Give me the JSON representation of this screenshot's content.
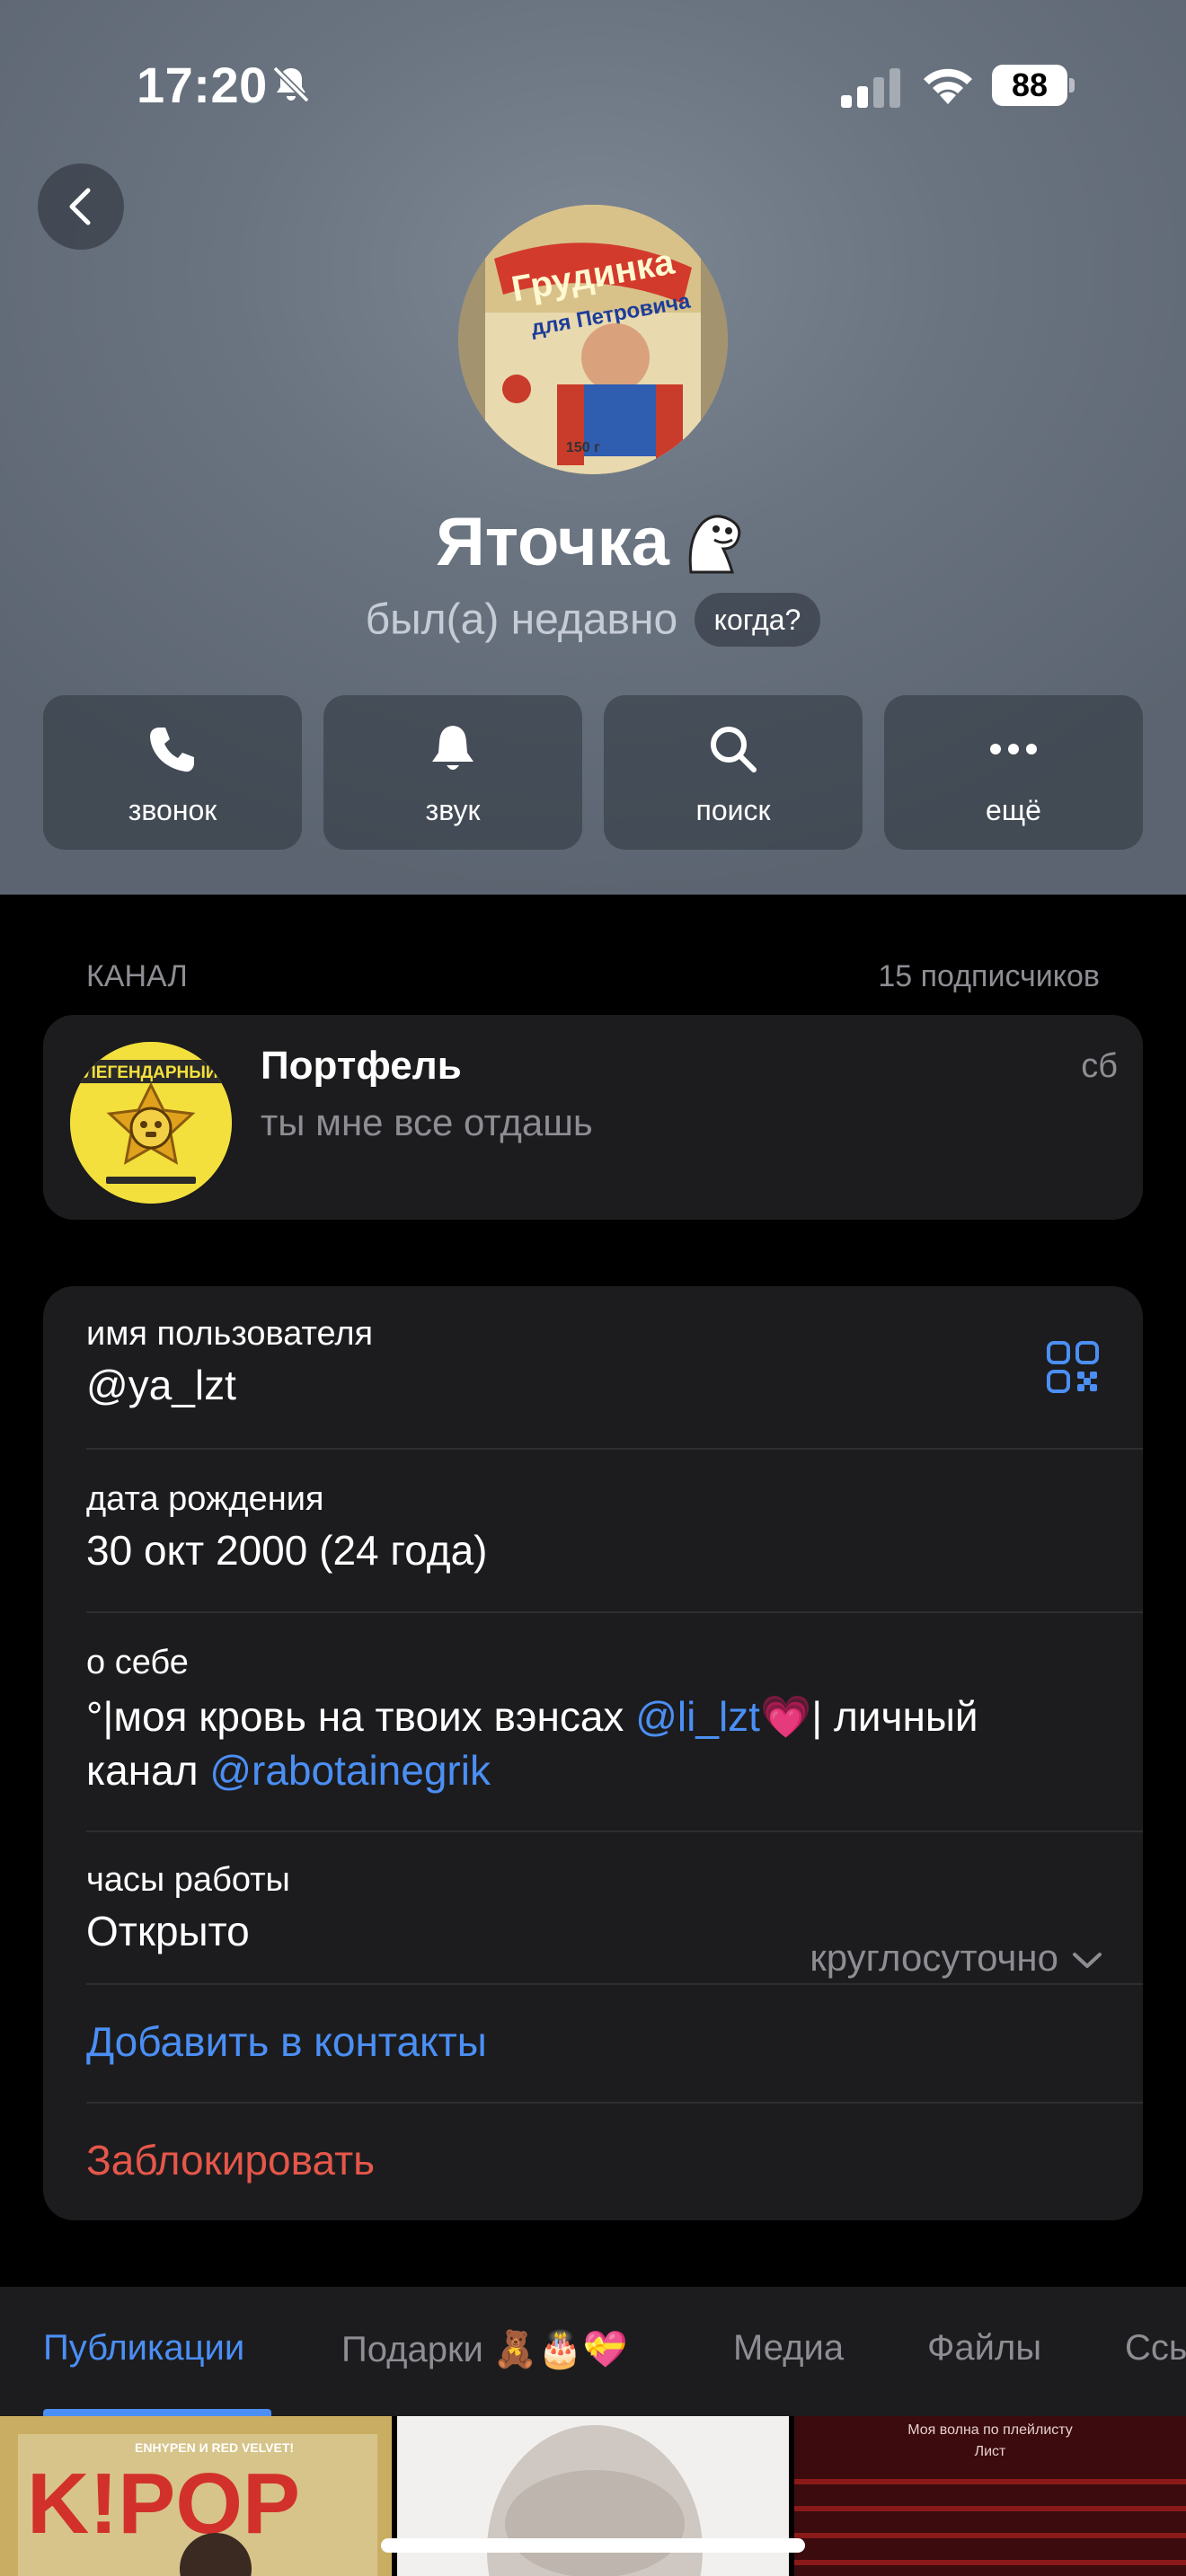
{
  "status_bar": {
    "time": "17:20",
    "battery": "88",
    "icons": [
      "bell-off-icon",
      "cellular-signal-icon",
      "wifi-icon",
      "battery-icon"
    ]
  },
  "profile": {
    "name": "Яточка",
    "status": "был(а) недавно",
    "when_button": "когда?",
    "avatar": {
      "title": "Грудинка",
      "subtitle": "для Петровича",
      "weight": "150 г"
    }
  },
  "actions": [
    {
      "label": "звонок",
      "icon": "phone-icon"
    },
    {
      "label": "звук",
      "icon": "bell-icon"
    },
    {
      "label": "поиск",
      "icon": "search-icon"
    },
    {
      "label": "ещё",
      "icon": "more-icon"
    }
  ],
  "channel_section": {
    "heading": "КАНАЛ",
    "subscribers": "15 подписчиков",
    "channel": {
      "name": "Портфель",
      "last_message": "ты мне все отдашь",
      "date": "сб",
      "avatar_text": "ЛЕГЕНДАРНЫЙ"
    }
  },
  "info": {
    "username_label": "имя пользователя",
    "username": "@ya_lzt",
    "birthday_label": "дата рождения",
    "birthday": "30 окт 2000 (24 года)",
    "about_label": "о себе",
    "about_part1": "°|моя кровь на твоих вэнсах ",
    "about_mention1": "@li_lzt",
    "about_heart": "💗",
    "about_part2": "| личный",
    "about_part3": "канал ",
    "about_mention2": "@rabotainegrik",
    "hours_label": "часы работы",
    "hours_status": "Открыто",
    "hours_value": "круглосуточно",
    "add_contact": "Добавить в контакты",
    "block": "Заблокировать"
  },
  "tabs": [
    {
      "label": "Публикации",
      "active": true
    },
    {
      "label": "Подарки 🧸🎂💝",
      "active": false
    },
    {
      "label": "Медиа",
      "active": false
    },
    {
      "label": "Файлы",
      "active": false
    },
    {
      "label": "Ссылки",
      "active": false
    }
  ],
  "grid": {
    "thumb1_text": "K!POP",
    "thumb1_sub": "ENHYPEN И RED VELVET!",
    "thumb3_text": "Моя волна по плейлисту",
    "thumb3_sub": "Лист"
  },
  "colors": {
    "accent": "#4b8ff5",
    "open": "#3ec45d",
    "danger": "#e5574a",
    "card": "#1c1c1e"
  }
}
